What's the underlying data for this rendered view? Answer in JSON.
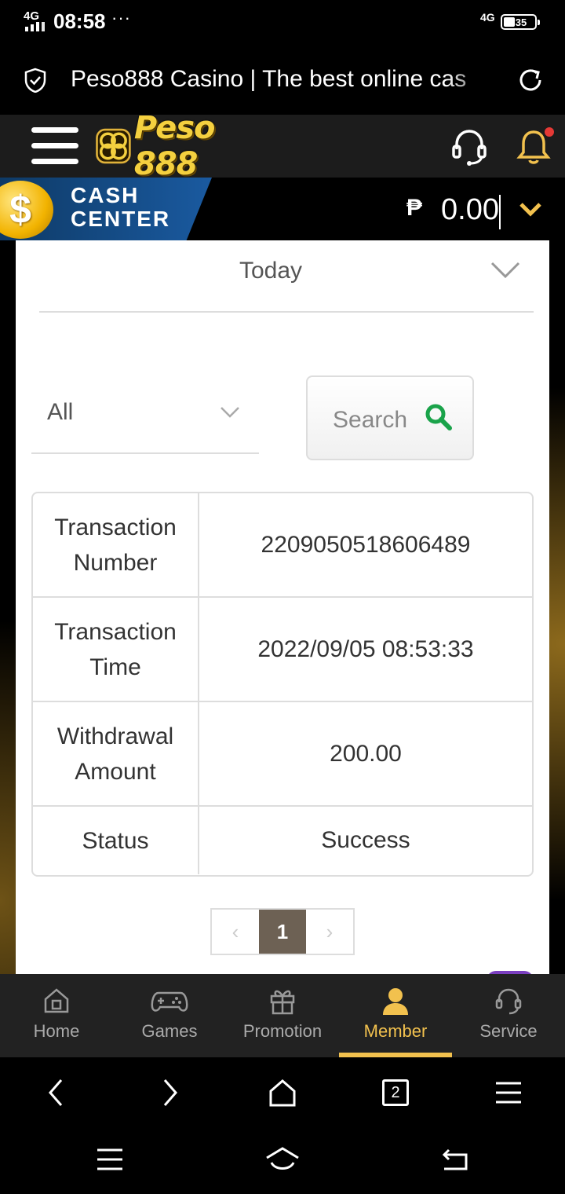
{
  "status_bar": {
    "network_left": "4G",
    "time": "08:58",
    "more": "···",
    "network_right": "4G",
    "battery": "35"
  },
  "browser": {
    "url_title": "Peso888 Casino | The best online cas",
    "tab_count": "2"
  },
  "header": {
    "logo_text": "Peso 888",
    "notification_dot_color": "#e53935"
  },
  "cash_center": {
    "label_line1": "CASH",
    "label_line2": "CENTER",
    "coin_symbol": "$",
    "currency_symbol": "₱",
    "balance": "0.00"
  },
  "filters": {
    "date_range": "Today",
    "type": "All",
    "search_label": "Search"
  },
  "transaction": {
    "rows": [
      {
        "key": "Transaction Number",
        "value": "2209050518606489"
      },
      {
        "key": "Transaction Time",
        "value": "2022/09/05 08:53:33"
      },
      {
        "key": "Withdrawal Amount",
        "value": "200.00"
      },
      {
        "key": "Status",
        "value": "Success"
      }
    ]
  },
  "pagination": {
    "prev": "‹",
    "current": "1",
    "next": "›"
  },
  "app_nav": {
    "items": [
      {
        "label": "Home",
        "icon": "home-icon"
      },
      {
        "label": "Games",
        "icon": "gamepad-icon"
      },
      {
        "label": "Promotion",
        "icon": "gift-icon"
      },
      {
        "label": "Member",
        "icon": "member-icon",
        "active": true
      },
      {
        "label": "Service",
        "icon": "headset-icon"
      }
    ]
  },
  "colors": {
    "accent": "#f2c14e",
    "search_icon": "#1aa34a",
    "pager_active": "#6d6154",
    "banner_blue": "#1a5aa0"
  }
}
